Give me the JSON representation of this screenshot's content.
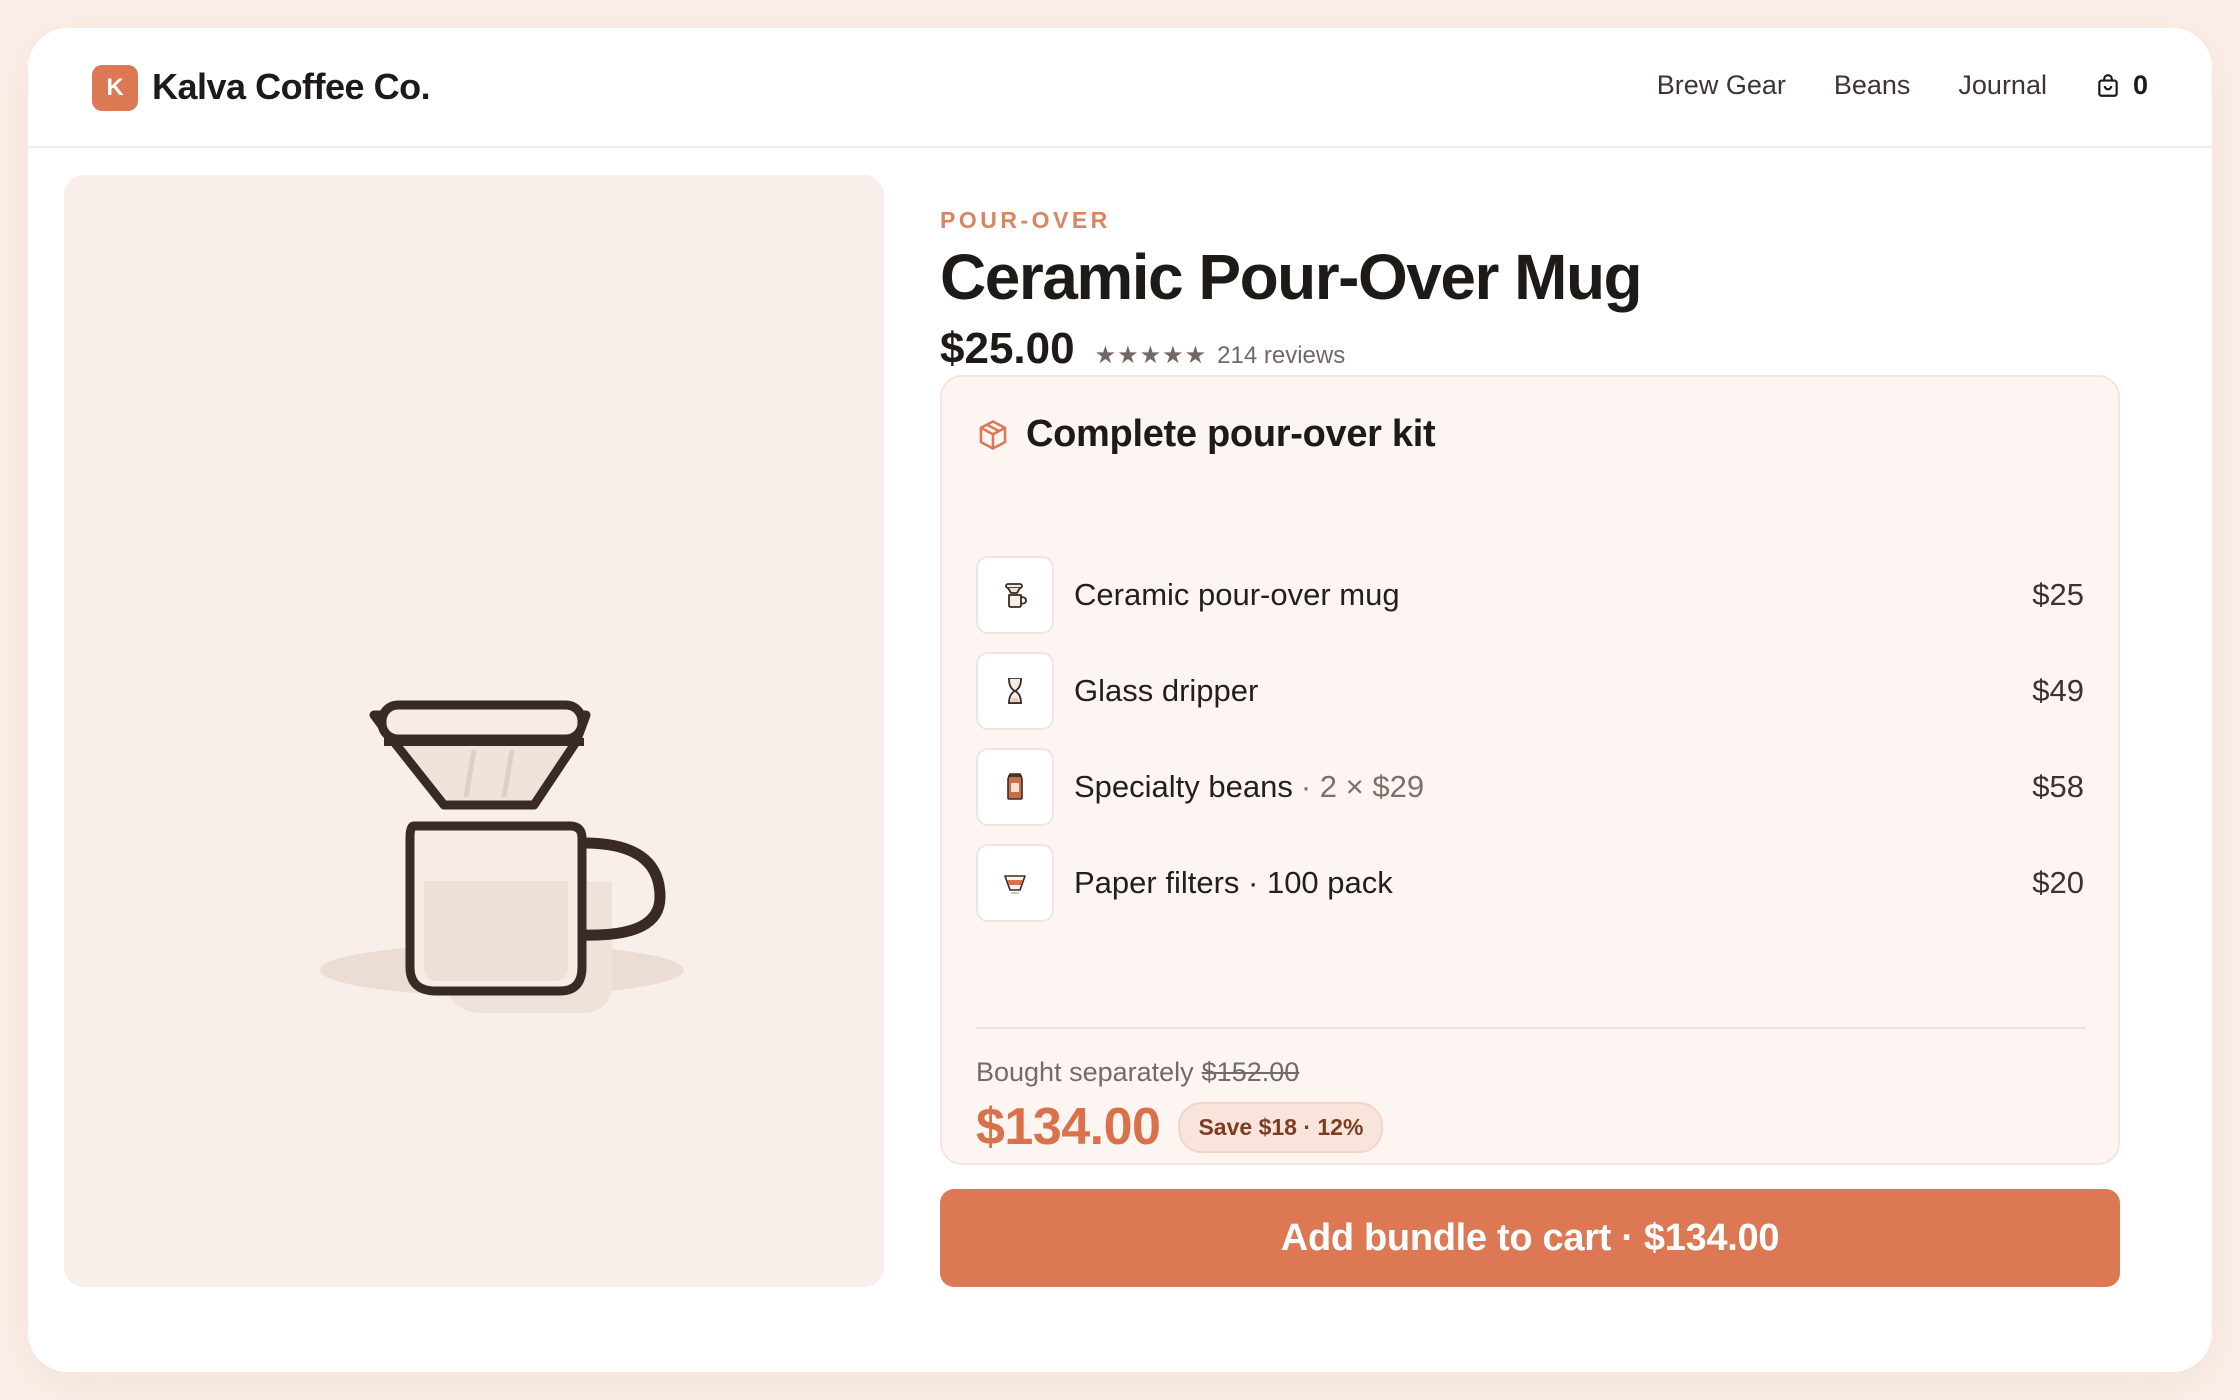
{
  "brand": {
    "logo_letter": "K",
    "name": "Kalva Coffee Co."
  },
  "nav": {
    "links": [
      "Brew Gear",
      "Beans",
      "Journal"
    ],
    "cart_count": "0"
  },
  "product": {
    "category": "POUR-OVER",
    "title": "Ceramic Pour-Over Mug",
    "price": "$25.00",
    "stars": "★★★★★",
    "rating": 5,
    "reviews": "214 reviews"
  },
  "bundle": {
    "title": "Complete pour-over kit",
    "items": [
      {
        "name": "Ceramic pour-over mug",
        "qty": "",
        "price": "$25",
        "icon": "mug-icon"
      },
      {
        "name": "Glass dripper",
        "qty": "",
        "price": "$49",
        "icon": "dripper-icon"
      },
      {
        "name": "Specialty beans",
        "qty": "· 2 × $29",
        "price": "$58",
        "icon": "bean-bag-icon"
      },
      {
        "name": "Paper filters · 100 pack",
        "qty": "",
        "price": "$20",
        "icon": "filter-icon"
      }
    ],
    "separately_label": "Bought separately",
    "separately_price": "$152.00",
    "total": "$134.00",
    "savings": "Save $18 · 12%"
  },
  "cta": {
    "label": "Add bundle to cart · $134.00"
  },
  "colors": {
    "accent": "#dc7854",
    "background": "#fbeee8",
    "hero_bg": "#f9efea",
    "bundle_bg": "#fdf5f1"
  }
}
